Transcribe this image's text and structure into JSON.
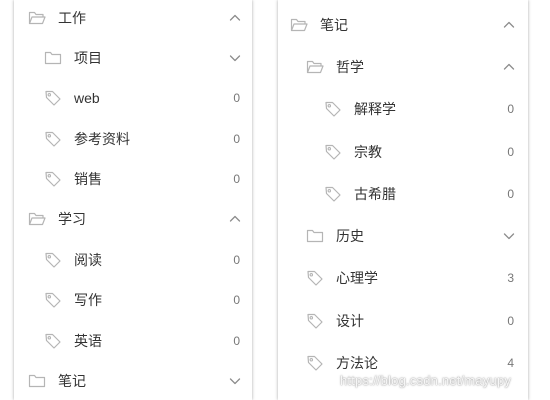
{
  "left_panel": {
    "rows": [
      {
        "type": "folder",
        "label": "工作",
        "chevron": "up"
      },
      {
        "type": "folder",
        "label": "项目",
        "chevron": "down"
      },
      {
        "type": "tag",
        "label": "web",
        "count": "0"
      },
      {
        "type": "tag",
        "label": "参考资料",
        "count": "0"
      },
      {
        "type": "tag",
        "label": "销售",
        "count": "0"
      },
      {
        "type": "folder",
        "label": "学习",
        "chevron": "up"
      },
      {
        "type": "tag",
        "label": "阅读",
        "count": "0"
      },
      {
        "type": "tag",
        "label": "写作",
        "count": "0"
      },
      {
        "type": "tag",
        "label": "英语",
        "count": "0"
      },
      {
        "type": "folder",
        "label": "笔记",
        "chevron": "down"
      }
    ]
  },
  "right_panel": {
    "rows": [
      {
        "type": "folder",
        "label": "笔记",
        "chevron": "up"
      },
      {
        "type": "folder",
        "label": "哲学",
        "chevron": "up"
      },
      {
        "type": "tag",
        "label": "解释学",
        "count": "0"
      },
      {
        "type": "tag",
        "label": "宗教",
        "count": "0"
      },
      {
        "type": "tag",
        "label": "古希腊",
        "count": "0"
      },
      {
        "type": "folder",
        "label": "历史",
        "chevron": "down"
      },
      {
        "type": "tag",
        "label": "心理学",
        "count": "3"
      },
      {
        "type": "tag",
        "label": "设计",
        "count": "0"
      },
      {
        "type": "tag",
        "label": "方法论",
        "count": "4"
      }
    ]
  },
  "watermark": "https://blog.csdn.net/mayupy",
  "colors": {
    "icon": "#b5b5b5",
    "chevron": "#8c8c8c",
    "text": "#333333",
    "count": "#777777"
  }
}
